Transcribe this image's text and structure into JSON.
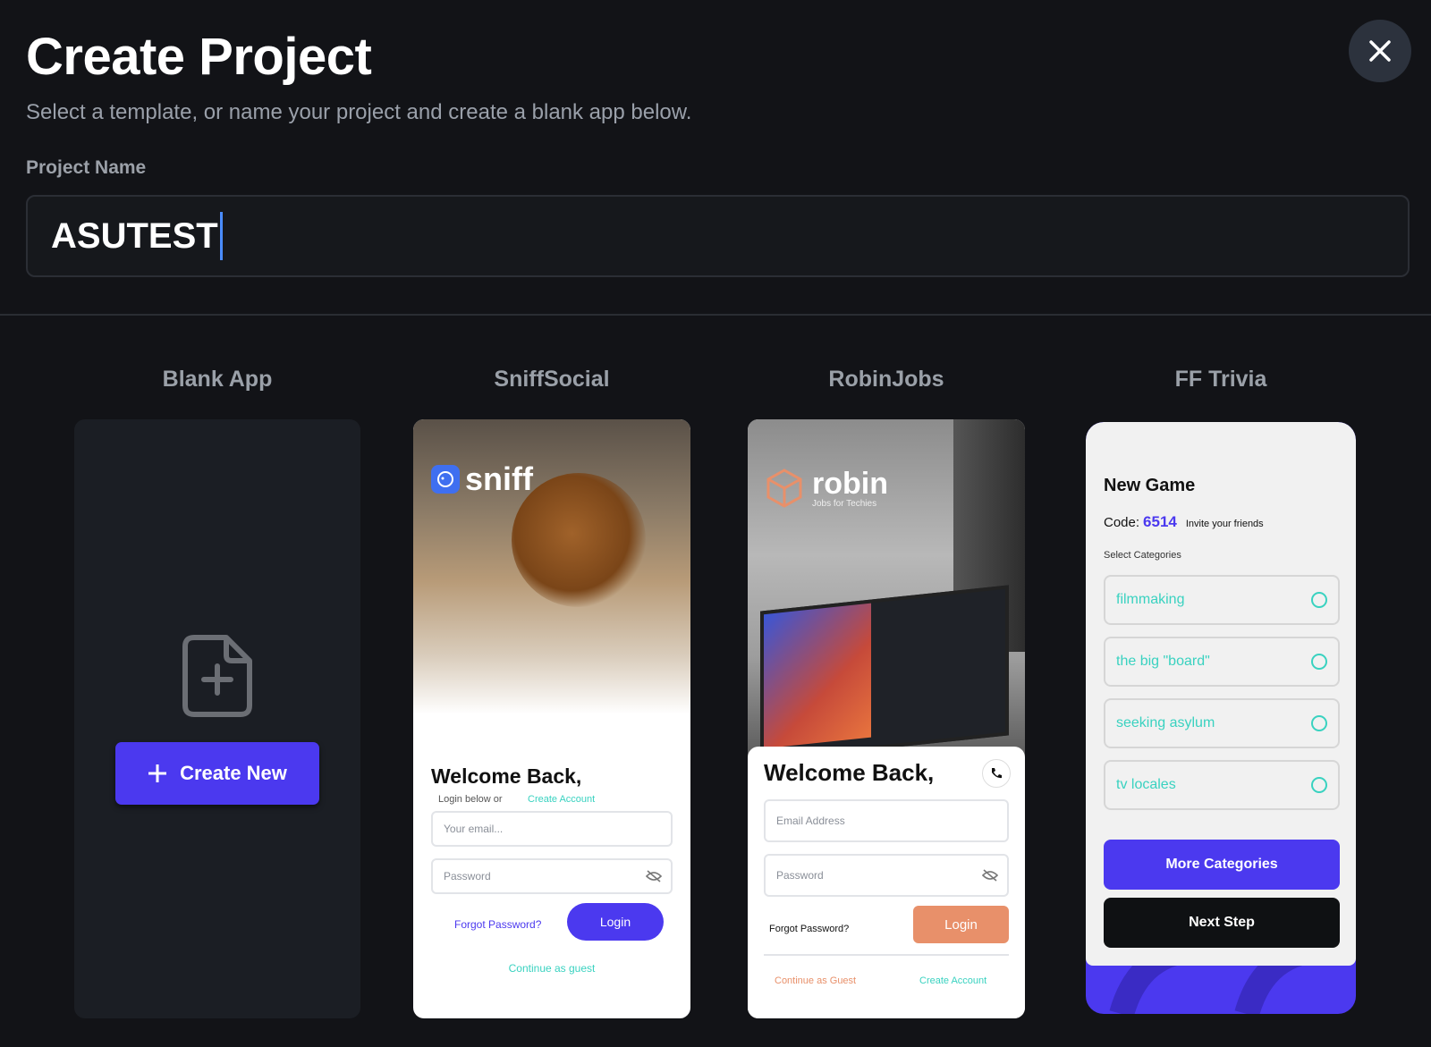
{
  "header": {
    "title": "Create Project",
    "subtitle": "Select a template, or name your project and create a blank app below.",
    "name_label": "Project Name",
    "name_value": "ASUTEST"
  },
  "close_icon": "close-icon",
  "templates": [
    {
      "title": "Blank App",
      "button_label": "Create New"
    },
    {
      "title": "SniffSocial"
    },
    {
      "title": "RobinJobs"
    },
    {
      "title": "FF Trivia"
    }
  ],
  "sniff": {
    "logo": "sniff",
    "welcome": "Welcome Back,",
    "login_below": "Login below or",
    "create_account": "Create Account",
    "email_placeholder": "Your email...",
    "password_placeholder": "Password",
    "forgot": "Forgot Password?",
    "login": "Login",
    "guest": "Continue as guest"
  },
  "robin": {
    "logo": "robin",
    "tagline": "Jobs for Techies",
    "welcome": "Welcome Back,",
    "email_placeholder": "Email Address",
    "password_placeholder": "Password",
    "forgot": "Forgot Password?",
    "login": "Login",
    "guest": "Continue as Guest",
    "create_account": "Create Account"
  },
  "trivia": {
    "heading": "New Game",
    "code_label": "Code:",
    "code": "6514",
    "invite": "Invite your friends",
    "select_label": "Select Categories",
    "categories": [
      "filmmaking",
      "the big \"board\"",
      "seeking asylum",
      "tv locales"
    ],
    "more_button": "More Categories",
    "next_button": "Next Step"
  },
  "colors": {
    "accent": "#4b39ef",
    "robin_orange": "#e8906a",
    "teal": "#39d2c0",
    "background": "#121317"
  }
}
